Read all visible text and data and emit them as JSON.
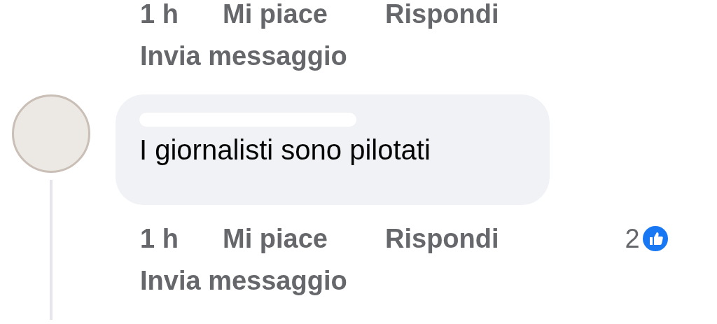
{
  "previous_comment": {
    "actions": [
      {
        "label": "1 h"
      },
      {
        "label": "Mi piace"
      },
      {
        "label": "Rispondi"
      }
    ],
    "message_link": "Invia messaggio"
  },
  "comment": {
    "text": "I giornalisti sono pilotati",
    "actions": [
      {
        "label": "1 h"
      },
      {
        "label": "Mi piace"
      },
      {
        "label": "Rispondi"
      }
    ],
    "message_link": "Invia messaggio",
    "reaction_count": "2"
  }
}
